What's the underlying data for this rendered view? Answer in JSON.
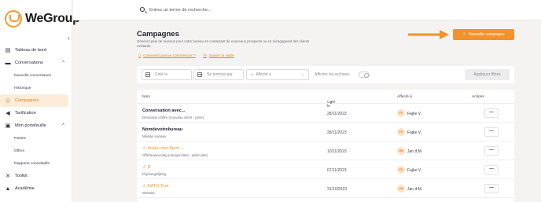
{
  "app": {
    "logo_text": "WeGroup"
  },
  "search": {
    "placeholder": "Entrez un terme de recherche..."
  },
  "sidebar": {
    "items": [
      {
        "label": "Tableau de bord",
        "icon": "dashboard-icon"
      },
      {
        "label": "Conversations",
        "icon": "chat-icon",
        "expanded": true
      },
      {
        "label": "Nouvelle conversation",
        "sub": true
      },
      {
        "label": "Historique",
        "sub": true
      },
      {
        "label": "Campagnes",
        "icon": "target-icon",
        "active": true
      },
      {
        "label": "Tarification",
        "icon": "megaphone-icon"
      },
      {
        "label": "Mon portefeuille",
        "icon": "briefcase-icon",
        "expanded": true
      },
      {
        "label": "Parties",
        "sub": true
      },
      {
        "label": "Offres",
        "sub": true
      },
      {
        "label": "Rapports consultatifs",
        "sub": true
      },
      {
        "label": "Toolkit",
        "icon": "tools-icon"
      },
      {
        "label": "Académie",
        "icon": "graduation-icon"
      }
    ]
  },
  "header": {
    "title": "Campagnes",
    "description": "Générez plus de revenus pour votre bureau en contactant de nouveaux prospects ou en réengageant des clients existants.",
    "link_howto": "Comment puis-je commencer ?",
    "link_tour": "Suivez la visite",
    "new_button": "Nouvelle campagne"
  },
  "filters": {
    "created": "Créé le",
    "ends": "Se termine par",
    "assigned": "Affecté à",
    "archives": "Afficher les archives",
    "apply": "Appliquer filtres"
  },
  "table": {
    "columns": {
      "name": "Nom",
      "created": "Créé le",
      "assigned": "Affecté à",
      "actions": "Actions"
    },
    "rows": [
      {
        "name": "Conversation avec...",
        "subtitle": "Demande d'offre (nouveau client - privé)",
        "date": "28/11/2023",
        "initials": "FV",
        "user": "Fajke V.",
        "warning": false
      },
      {
        "name": "Nomdevotrebureau",
        "subtitle": "Médias sociaux",
        "date": "28/11/2023",
        "initials": "FV",
        "user": "Fajke V.",
        "warning": false
      },
      {
        "name": "Intake met Bjorn ...",
        "subtitle": "Offerteaanvraag (nieuwe klant - particulier)",
        "date": "10/11/2023",
        "initials": "JM",
        "user": "Jan d.M.",
        "warning": true
      },
      {
        "name": "R",
        "subtitle": "Prijsvergelijking",
        "date": "07/11/2023",
        "initials": "FV",
        "user": "Fajke V.",
        "warning": true
      },
      {
        "name": "NATO Test",
        "subtitle": "Website",
        "date": "31/10/2023",
        "initials": "JM",
        "user": "Jan d.M.",
        "warning": true
      }
    ]
  },
  "colors": {
    "accent": "#f3912b",
    "warning": "#ec9a2d",
    "active_bg": "#fdecd9"
  }
}
